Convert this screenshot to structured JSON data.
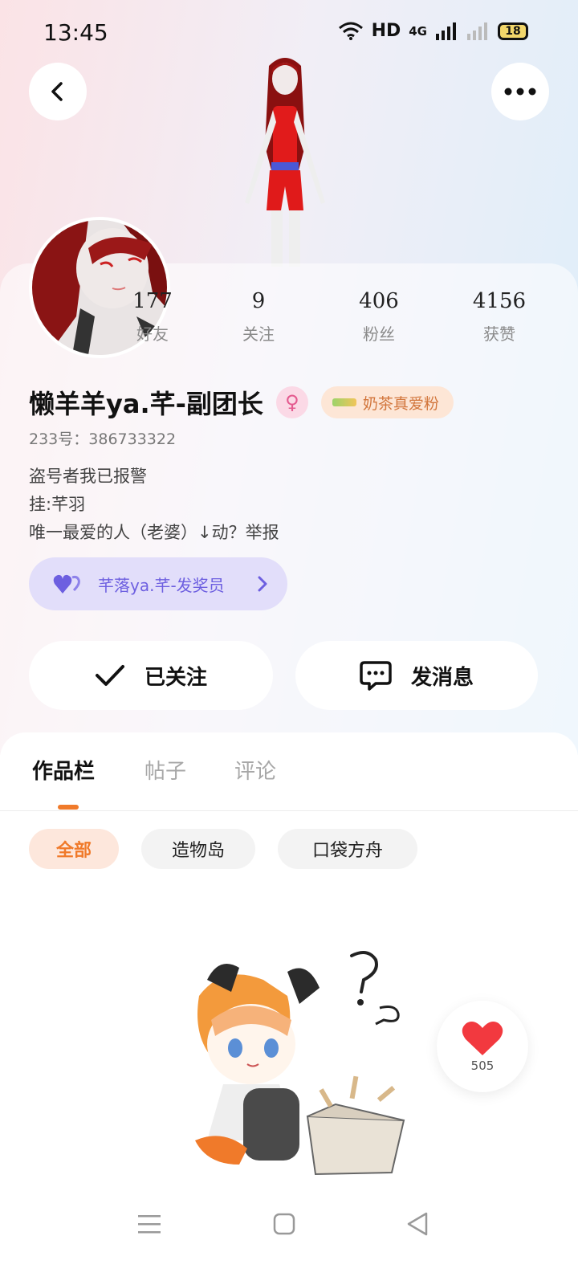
{
  "status_bar": {
    "time": "13:45",
    "network": "HD",
    "signal": "4G",
    "battery": "18"
  },
  "header": {
    "back_icon": "chevron-left-icon",
    "more_icon": "more-dots-icon"
  },
  "profile": {
    "stats": [
      {
        "value": "177",
        "label": "好友"
      },
      {
        "value": "9",
        "label": "关注"
      },
      {
        "value": "406",
        "label": "粉丝"
      },
      {
        "value": "4156",
        "label": "获赞"
      }
    ],
    "username": "懒羊羊ya.芊-副团长",
    "gender_icon": "female-icon",
    "fan_badge": "奶茶真爱粉",
    "id_line": "233号：386733322",
    "bio_lines": [
      "盗号者我已报警",
      "挂:芊羽",
      "唯一最爱的人（老婆）↓动？举报"
    ],
    "title_pill": "芊落ya.芊-发奖员",
    "follow_button": "已关注",
    "message_button": "发消息"
  },
  "tabs": [
    {
      "label": "作品栏",
      "active": true
    },
    {
      "label": "帖子",
      "active": false
    },
    {
      "label": "评论",
      "active": false
    }
  ],
  "filters": [
    {
      "label": "全部",
      "active": true
    },
    {
      "label": "造物岛",
      "active": false
    },
    {
      "label": "口袋方舟",
      "active": false
    }
  ],
  "like_float": {
    "count": "505"
  },
  "colors": {
    "accent": "#f07a2a",
    "purple": "#6d5fe0",
    "like_red": "#f2393f"
  }
}
